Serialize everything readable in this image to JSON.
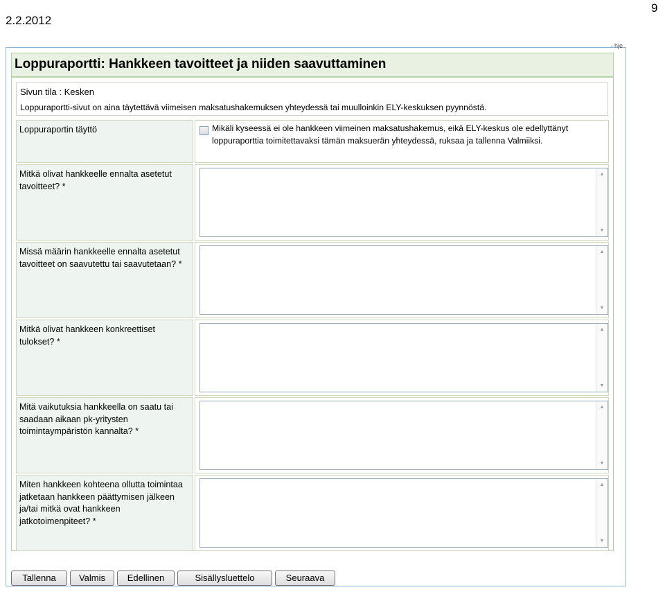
{
  "header": {
    "date": "2.2.2012",
    "page_number": "9"
  },
  "form": {
    "top_cutoff_text": "- hje",
    "title": "Loppuraportti: Hankkeen tavoitteet ja niiden saavuttaminen",
    "status": "Sivun tila : Kesken",
    "instruction": "Loppuraportti-sivut on aina täytettävä viimeisen maksatushakemuksen yhteydessä tai muulloinkin ELY-keskuksen pyynnöstä.",
    "fill_section": {
      "label": "Loppuraportin täyttö",
      "checkbox_checked": false,
      "checkbox_text": "Mikäli kyseessä ei ole hankkeen viimeinen maksatushakemus, eikä ELY-keskus ole edellyttänyt loppuraporttia toimitettavaksi tämän maksuerän yhteydessä, ruksaa ja tallenna Valmiiksi."
    },
    "questions": [
      {
        "label": "Mitkä olivat hankkeelle ennalta asetetut tavoitteet? *",
        "value": ""
      },
      {
        "label": "Missä määrin hankkeelle ennalta asetetut tavoitteet on saavutettu tai saavutetaan? *",
        "value": ""
      },
      {
        "label": "Mitkä olivat hankkeen konkreettiset tulokset? *",
        "value": ""
      },
      {
        "label": "Mitä vaikutuksia hankkeella on saatu tai saadaan aikaan pk-yritysten toimintaympäristön kannalta? *",
        "value": ""
      },
      {
        "label": "Miten hankkeen kohteena ollutta toimintaa jatketaan hankkeen päättymisen jälkeen ja/tai mitkä ovat hankkeen jatkotoimenpiteet? *",
        "value": ""
      }
    ]
  },
  "buttons": {
    "save": "Tallenna",
    "done": "Valmis",
    "previous": "Edellinen",
    "toc": "Sisällysluettelo",
    "next": "Seuraava"
  },
  "icons": {
    "scroll_up": "scroll-up-arrow",
    "scroll_down": "scroll-down-arrow"
  }
}
